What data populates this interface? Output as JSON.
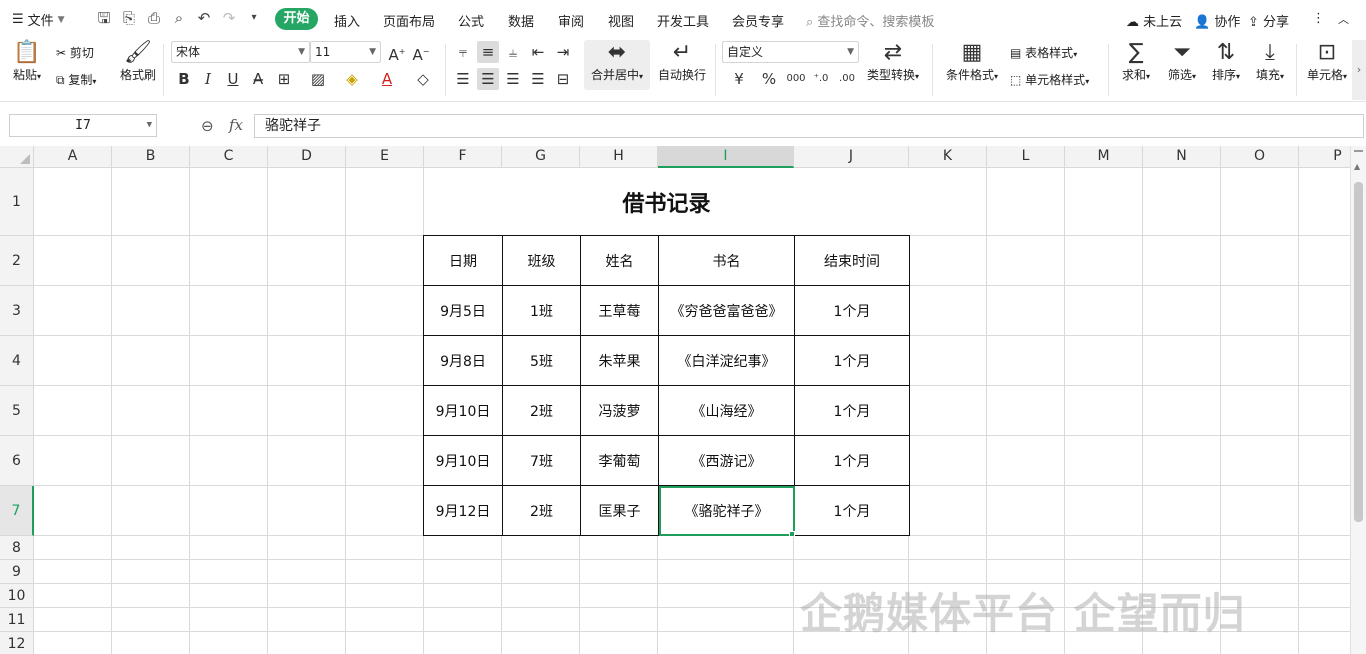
{
  "menubar": {
    "file_label": "文件",
    "tabs": [
      "开始",
      "插入",
      "页面布局",
      "公式",
      "数据",
      "审阅",
      "视图",
      "开发工具",
      "会员专享"
    ],
    "search_placeholder": "查找命令、搜索模板",
    "cloud_label": "未上云",
    "collab_label": "协作",
    "share_label": "分享"
  },
  "ribbon": {
    "paste_label": "粘贴",
    "cut_label": "剪切",
    "copy_label": "复制",
    "format_painter_label": "格式刷",
    "font_name": "宋体",
    "font_size": "11",
    "merge_center_label": "合并居中",
    "wrap_label": "自动换行",
    "number_format": "自定义",
    "type_convert_label": "类型转换",
    "conditional_format_label": "条件格式",
    "table_style_label": "表格样式",
    "cell_style_label": "单元格样式",
    "sum_label": "求和",
    "filter_label": "筛选",
    "sort_label": "排序",
    "fill_label": "填充",
    "cell_label": "单元格",
    "currency_symbol": "¥",
    "percent_symbol": "%",
    "thousands_symbol": "000"
  },
  "formula_bar": {
    "cell_ref": "I7",
    "fx": "fx",
    "content": "骆驼祥子"
  },
  "sheet": {
    "columns": [
      "A",
      "B",
      "C",
      "D",
      "E",
      "F",
      "G",
      "H",
      "I",
      "J",
      "K",
      "L",
      "M",
      "N",
      "O",
      "P"
    ],
    "rows": [
      "1",
      "2",
      "3",
      "4",
      "5",
      "6",
      "7",
      "8",
      "9",
      "10",
      "11",
      "12"
    ],
    "active_col": "I",
    "active_row": "7",
    "title": "借书记录",
    "table": {
      "headers": [
        "日期",
        "班级",
        "姓名",
        "书名",
        "结束时间"
      ],
      "rows": [
        [
          "9月5日",
          "1班",
          "王草莓",
          "《穷爸爸富爸爸》",
          "1个月"
        ],
        [
          "9月8日",
          "5班",
          "朱苹果",
          "《白洋淀纪事》",
          "1个月"
        ],
        [
          "9月10日",
          "2班",
          "冯菠萝",
          "《山海经》",
          "1个月"
        ],
        [
          "9月10日",
          "7班",
          "李葡萄",
          "《西游记》",
          "1个月"
        ],
        [
          "9月12日",
          "2班",
          "匡果子",
          "《骆驼祥子》",
          "1个月"
        ]
      ]
    }
  },
  "watermark": "企鹅媒体平台 企望而归",
  "colors": {
    "accent": "#25a664",
    "selection": "#1e9e5a"
  }
}
